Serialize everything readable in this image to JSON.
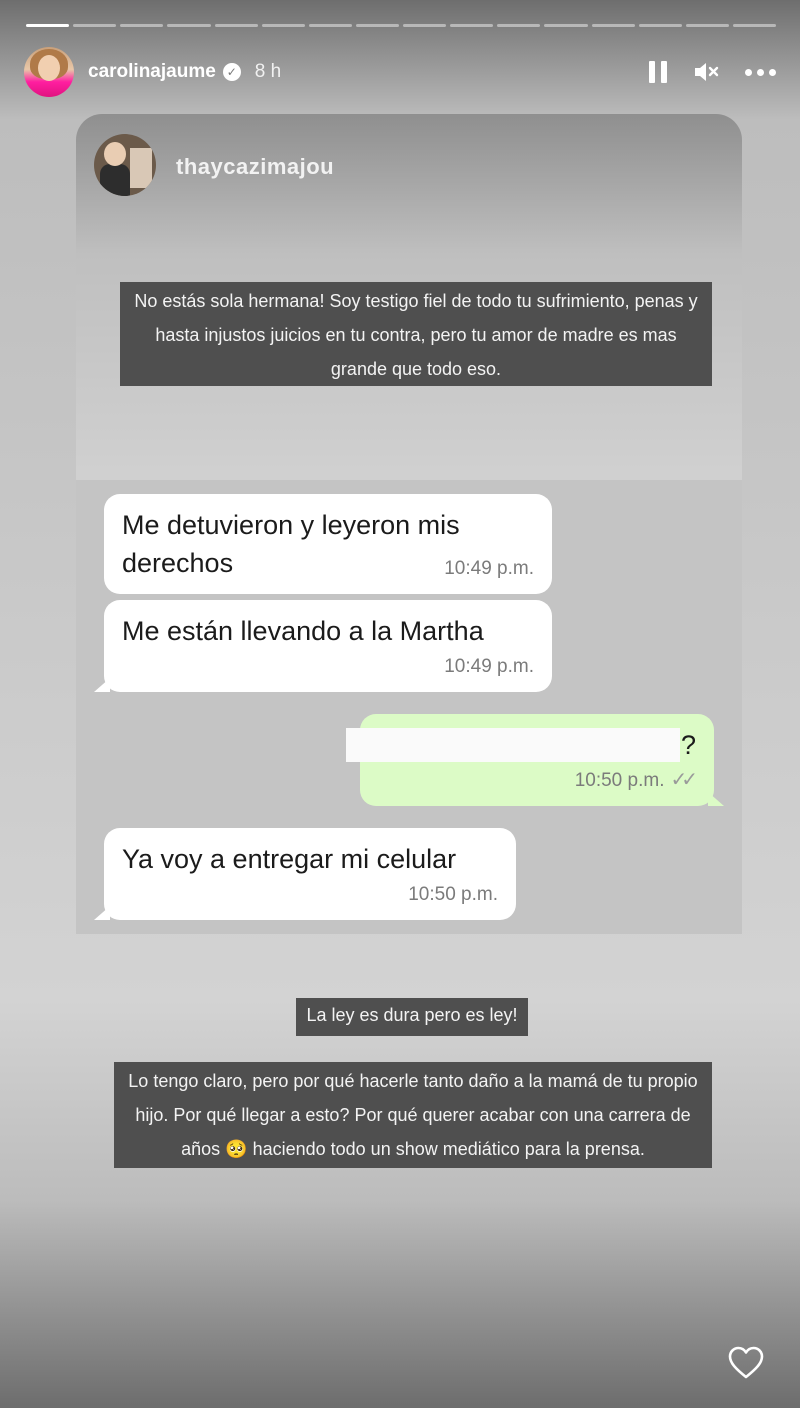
{
  "story": {
    "username": "carolinajaume",
    "time_ago": "8 h",
    "segments_total": 16,
    "segments_active": 1
  },
  "header_icons": [
    "verified-badge-icon",
    "pause-icon",
    "mute-icon",
    "more-icon"
  ],
  "quoted_post": {
    "username": "thaycazimajou",
    "caption": "No estás sola hermana! Soy testigo fiel de todo tu sufrimiento, penas y hasta injustos juicios en tu contra, pero tu amor de madre es mas grande que todo eso."
  },
  "chat": {
    "messages": [
      {
        "direction": "in",
        "text": "Me detuvieron y leyeron mis derechos",
        "time": "10:49 p.m."
      },
      {
        "direction": "in",
        "text": "Me están llevando a la Martha",
        "time": "10:49 p.m."
      },
      {
        "direction": "out",
        "text": "?",
        "time": "10:50 p.m.",
        "redacted": true
      },
      {
        "direction": "in",
        "text": "Ya voy a entregar mi celular",
        "time": "10:50 p.m."
      }
    ]
  },
  "captions": {
    "line1": "La ley es dura pero es ley!",
    "line2": "Lo tengo claro, pero por qué hacerle tanto  daño a la mamá de tu propio hijo. Por qué llegar a esto? Por qué querer acabar con una carrera de años 🥺 haciendo todo un show mediático para la prensa."
  },
  "footer": {
    "like_icon": "heart-icon"
  }
}
